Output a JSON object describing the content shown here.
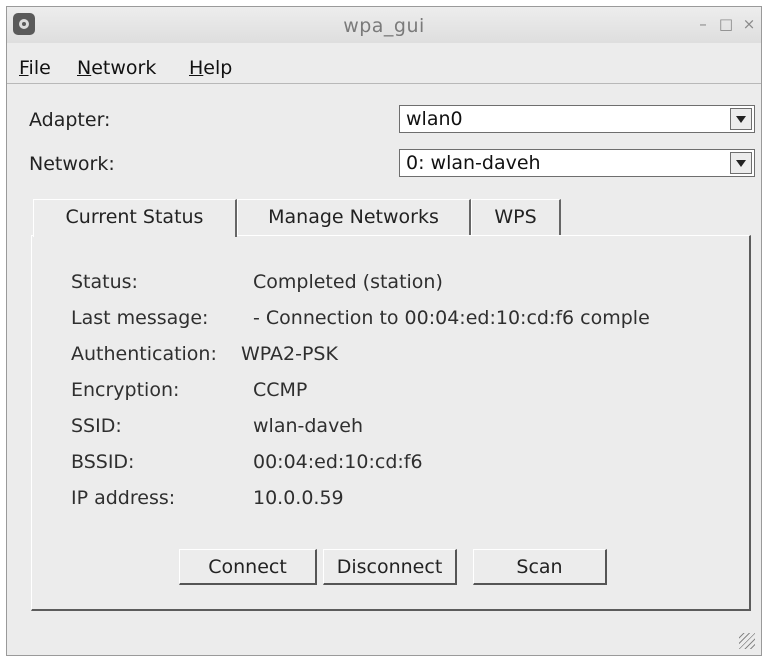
{
  "window": {
    "title": "wpa_gui",
    "minimize": "–",
    "maximize": "□",
    "close": "×"
  },
  "menu": [
    "File",
    "Network",
    "Help"
  ],
  "adapter": {
    "label": "Adapter:",
    "value": "wlan0"
  },
  "network": {
    "label": "Network:",
    "value": "0: wlan-daveh"
  },
  "tabs": [
    "Current Status",
    "Manage Networks",
    "WPS"
  ],
  "status": [
    {
      "label": "Status:",
      "value": "Completed (station)"
    },
    {
      "label": "Last message:",
      "value": "- Connection to 00:04:ed:10:cd:f6 comple"
    },
    {
      "label": "Authentication:",
      "value": "WPA2-PSK"
    },
    {
      "label": "Encryption:",
      "value": "CCMP"
    },
    {
      "label": "SSID:",
      "value": "wlan-daveh"
    },
    {
      "label": "BSSID:",
      "value": "00:04:ed:10:cd:f6"
    },
    {
      "label": "IP address:",
      "value": "10.0.0.59"
    }
  ],
  "buttons": {
    "connect": "Connect",
    "disconnect": "Disconnect",
    "scan": "Scan"
  }
}
